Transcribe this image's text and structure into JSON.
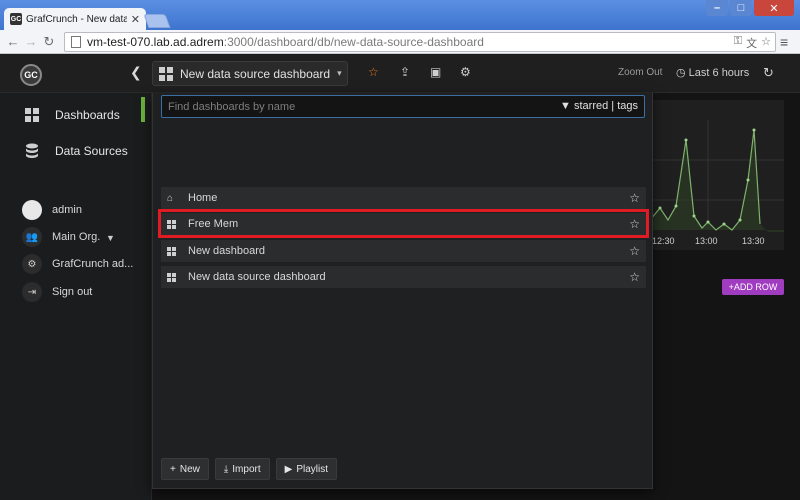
{
  "browser": {
    "tab_title": "GrafCrunch - New data sourc",
    "tab_favicon": "GC",
    "url_host": "vm-test-070.lab.ad.adrem",
    "url_path": ":3000/dashboard/db/new-data-source-dashboard"
  },
  "topnav": {
    "logo": "GC",
    "current_dashboard": "New data source dashboard",
    "zoom_out": "Zoom Out",
    "time_range": "Last 6 hours"
  },
  "sidebar": {
    "items": [
      {
        "label": "Dashboards",
        "icon": "grid-icon"
      },
      {
        "label": "Data Sources",
        "icon": "database-icon"
      }
    ],
    "user": {
      "name": "admin",
      "org": "Main Org.",
      "admin": "GrafCrunch ad...",
      "signout": "Sign out"
    }
  },
  "search": {
    "placeholder": "Find dashboards by name",
    "filter_label": "starred | tags",
    "results": [
      {
        "label": "Home",
        "icon": "home-icon"
      },
      {
        "label": "Free Mem",
        "icon": "grid-icon"
      },
      {
        "label": "New dashboard",
        "icon": "grid-icon"
      },
      {
        "label": "New data source dashboard",
        "icon": "grid-icon"
      }
    ],
    "buttons": {
      "new": "New",
      "import": "Import",
      "playlist": "Playlist"
    }
  },
  "panel": {
    "x_ticks": [
      "12:30",
      "13:00",
      "13:30"
    ],
    "add_row": "ADD ROW"
  },
  "colors": {
    "accent": "#eb7b18",
    "active": "#6ab23c",
    "highlight": "#e01b24",
    "add_row": "#a03cc0"
  }
}
